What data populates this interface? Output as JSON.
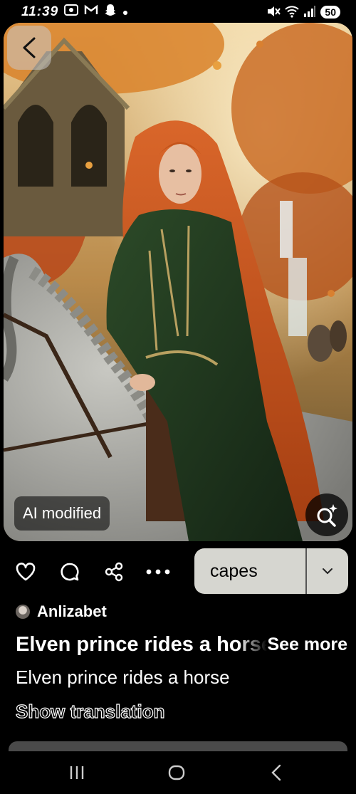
{
  "status_bar": {
    "time": "11:39",
    "battery": "50",
    "notification_icons": [
      "gallery-icon",
      "gmail-icon",
      "snapchat-icon",
      "dot-icon"
    ],
    "system_icons": [
      "mute-icon",
      "wifi-icon",
      "signal-icon",
      "battery-icon"
    ]
  },
  "image": {
    "ai_label": "AI modified"
  },
  "actions": {
    "icons": [
      "heart-icon",
      "comment-icon",
      "share-icon",
      "more-icon"
    ],
    "board_name": "capes"
  },
  "pin": {
    "author": "Anlizabet",
    "title": "Elven prince rides a horse",
    "see_more": "See more",
    "description": "Elven prince rides a horse",
    "show_translation": "Show translation"
  },
  "colors": {
    "background": "#000000",
    "board_select_bg": "#d6d6d0",
    "hair": "#c4541a",
    "tunic": "#22371f",
    "horse": "#a9a9a4",
    "foliage": "#d9822a"
  }
}
